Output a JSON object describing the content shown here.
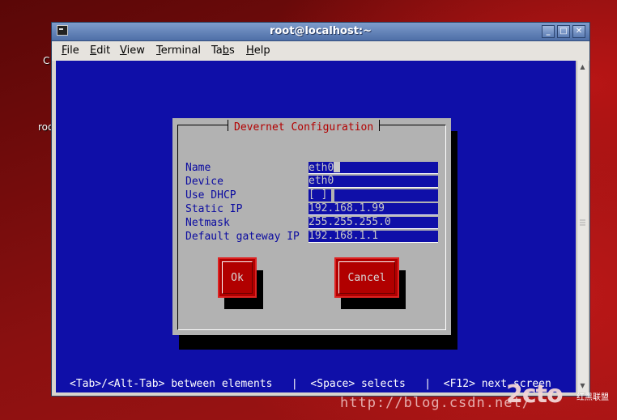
{
  "window": {
    "title": "root@localhost:~",
    "controls": {
      "minimize": "_",
      "maximize": "□",
      "close": "✕"
    }
  },
  "menubar": {
    "items": [
      {
        "label": "File",
        "mnemonic": "F",
        "rest": "ile"
      },
      {
        "label": "Edit",
        "mnemonic": "E",
        "rest": "dit"
      },
      {
        "label": "View",
        "mnemonic": "V",
        "rest": "iew"
      },
      {
        "label": "Terminal",
        "mnemonic": "T",
        "rest": "erminal"
      },
      {
        "label": "Tabs",
        "mnemonic": "b",
        "pre": "Ta",
        "rest": "s"
      },
      {
        "label": "Help",
        "mnemonic": "H",
        "rest": "elp"
      }
    ]
  },
  "desktop": {
    "partial_labels": [
      "C",
      "roo"
    ]
  },
  "dialog": {
    "title": "Devernet Configuration",
    "fields": [
      {
        "label": "Name",
        "value": "eth0"
      },
      {
        "label": "Device",
        "value": "eth0"
      },
      {
        "label": "Use DHCP",
        "value": "[ ]"
      },
      {
        "label": "Static IP",
        "value": "192.168.1.99"
      },
      {
        "label": "Netmask",
        "value": "255.255.255.0"
      },
      {
        "label": "Default gateway IP",
        "value": "192.168.1.1"
      }
    ],
    "buttons": {
      "ok": "Ok",
      "cancel": "Cancel"
    }
  },
  "helpline": "<Tab>/<Alt-Tab> between elements   |  <Space> selects   |  <F12> next screen",
  "watermark": {
    "url": "http://blog.csdn.net/",
    "logo": "2cto",
    "small": "红黑联盟"
  },
  "colors": {
    "terminal_bg": "#0f0fa8",
    "dialog_bg": "#b2b2b2",
    "button_red": "#b10000",
    "title_red": "#b30000"
  }
}
